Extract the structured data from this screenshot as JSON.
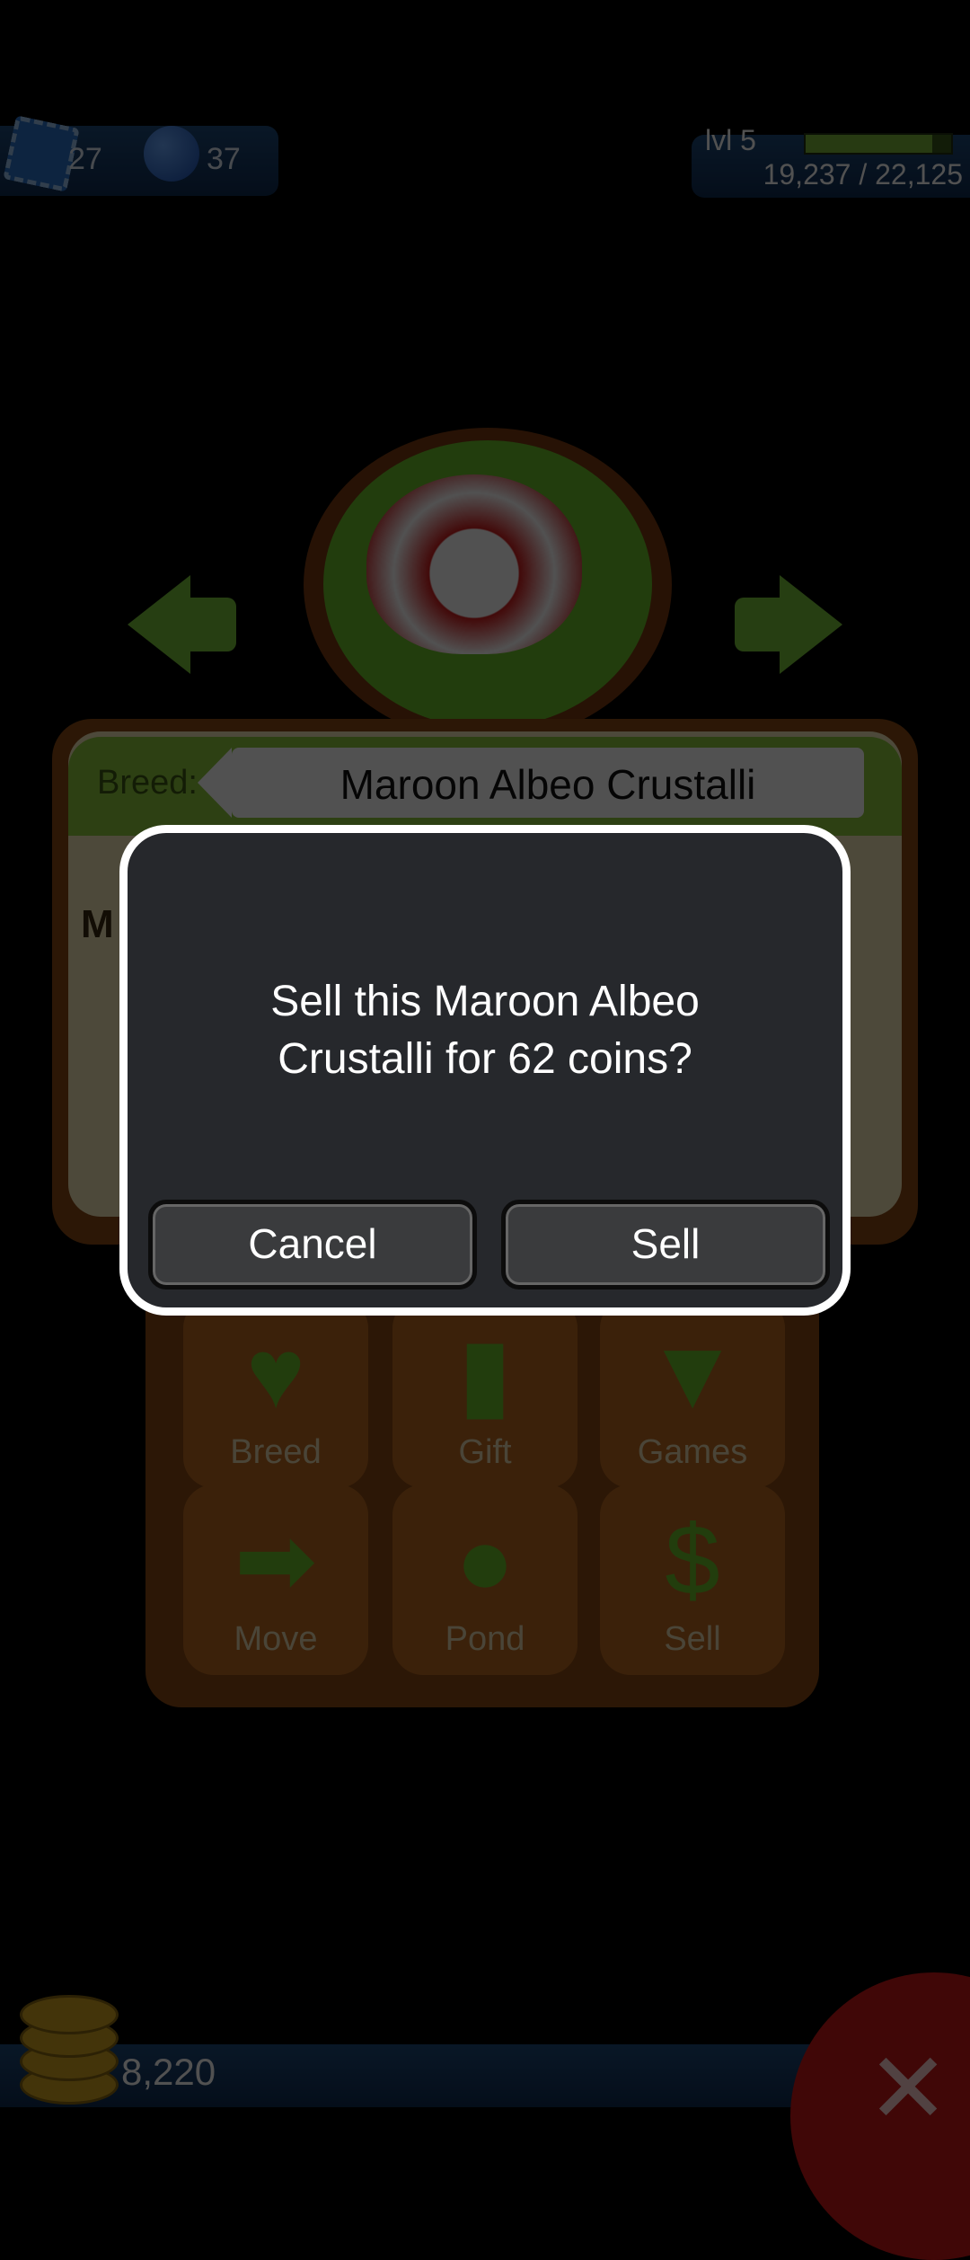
{
  "hud": {
    "stamps_count": "27",
    "potions_count": "37",
    "level_label": "lvl 5",
    "xp_text": "19,237 / 22,125",
    "xp_progress": 0.87
  },
  "pet": {
    "breed_label": "Breed:",
    "breed_name": "Maroon Albeo Crustalli",
    "partial_label": "M"
  },
  "actions": [
    {
      "label": "Breed",
      "icon": "heart-icon"
    },
    {
      "label": "Gift",
      "icon": "gift-icon"
    },
    {
      "label": "Games",
      "icon": "spinning-top-icon"
    },
    {
      "label": "Move",
      "icon": "arrow-right-icon"
    },
    {
      "label": "Pond",
      "icon": "lily-pad-icon"
    },
    {
      "label": "Sell",
      "icon": "dollar-icon"
    }
  ],
  "dialog": {
    "message_line1": "Sell this Maroon Albeo",
    "message_line2": "Crustalli for 62 coins?",
    "cancel_label": "Cancel",
    "confirm_label": "Sell"
  },
  "footer": {
    "coin_count": "8,220"
  },
  "colors": {
    "accent_green": "#78c23a",
    "panel_brown": "#8a4a14",
    "dialog_bg": "#26282c"
  }
}
